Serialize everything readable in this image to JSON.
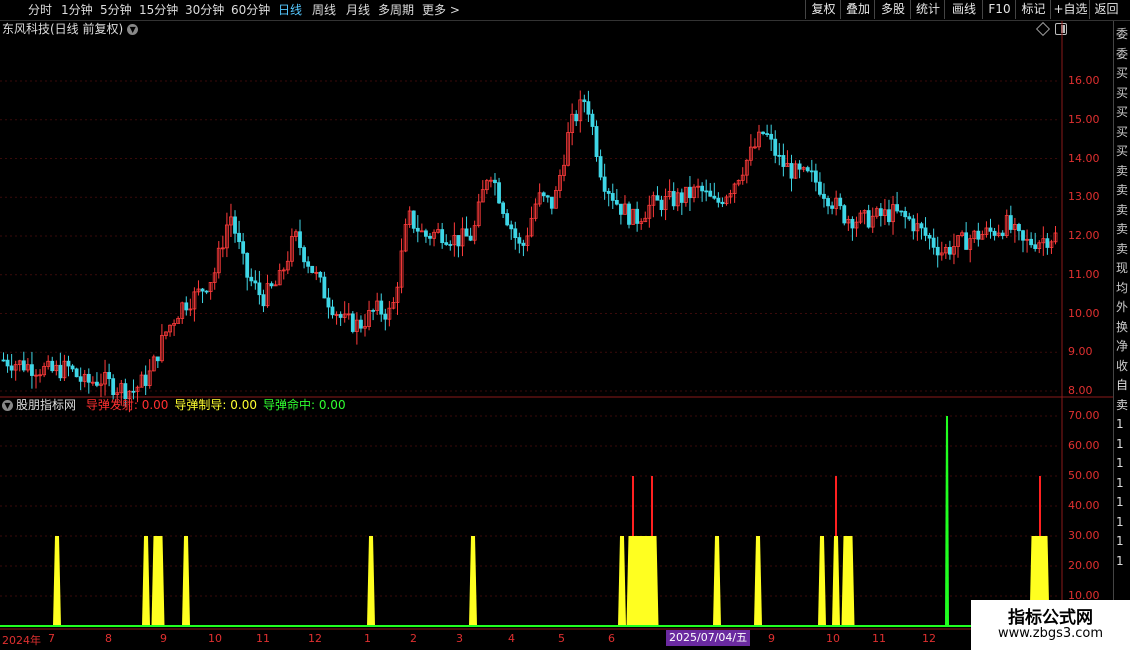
{
  "toolbar": {
    "periods": [
      {
        "label": "分时",
        "active": false
      },
      {
        "label": "1分钟",
        "active": false
      },
      {
        "label": "5分钟",
        "active": false
      },
      {
        "label": "15分钟",
        "active": false
      },
      {
        "label": "30分钟",
        "active": false
      },
      {
        "label": "60分钟",
        "active": false
      },
      {
        "label": "日线",
        "active": true
      },
      {
        "label": "周线",
        "active": false
      },
      {
        "label": "月线",
        "active": false
      },
      {
        "label": "多周期",
        "active": false
      },
      {
        "label": "更多 >",
        "active": false
      }
    ],
    "actions": [
      "复权",
      "叠加",
      "多股",
      "统计",
      "画线",
      "F10",
      "标记",
      "+自选",
      "返回"
    ]
  },
  "main": {
    "title": "东风科技(日线 前复权)",
    "price_axis": [
      "16.00",
      "15.00",
      "14.00",
      "13.00",
      "12.00",
      "11.00",
      "10.00",
      "9.00",
      "8.00"
    ]
  },
  "indicator": {
    "name": "股朋指标网",
    "items": [
      {
        "label": "导弹发射:",
        "value": "0.00",
        "color": "#ff3030"
      },
      {
        "label": "导弹制导:",
        "value": "0.00",
        "color": "#ffff30"
      },
      {
        "label": "导弹命中:",
        "value": "0.00",
        "color": "#30ff30"
      }
    ],
    "axis": [
      "70.00",
      "60.00",
      "50.00",
      "40.00",
      "30.00",
      "20.00",
      "10.00"
    ]
  },
  "time_axis": [
    "2024年",
    "7",
    "8",
    "9",
    "10",
    "11",
    "12",
    "1",
    "2",
    "3",
    "4",
    "5",
    "6",
    "9",
    "10",
    "11",
    "12"
  ],
  "date_badge": "2025/07/04/五",
  "watermark": {
    "title": "指标公式网",
    "url": "www.zbgs3.com"
  },
  "chart_data": [
    {
      "type": "line",
      "title": "东风科技(日线 前复权)",
      "series": [
        {
          "values": [
            8.8,
            8.7,
            8.6,
            8.5,
            8.6,
            8.2,
            8.3,
            8.1,
            8.0,
            8.4,
            9.5,
            10.2,
            10.5,
            11.0,
            12.6,
            11.0,
            10.4,
            10.8,
            12.0,
            11.2,
            10.4,
            9.8,
            9.7,
            10.1,
            10.0,
            12.5,
            12.0,
            12.1,
            11.9,
            12.0,
            13.8,
            12.6,
            11.6,
            13.0,
            12.8,
            14.8,
            15.6,
            13.5,
            12.8,
            12.4,
            12.8,
            12.9,
            13.0,
            13.2,
            12.8,
            13.3,
            14.0,
            14.7,
            13.9,
            13.6,
            13.5,
            13.0,
            12.5,
            12.4,
            12.5,
            12.6,
            12.4,
            12.0,
            11.6,
            11.8,
            12.0,
            12.1,
            12.3,
            11.8,
            11.9,
            12.0
          ]
        }
      ],
      "ylim": [
        7.6,
        16.5
      ]
    },
    {
      "type": "bar",
      "series": [
        {
          "name": "导弹发射",
          "color": "#ff2020",
          "values": [
            0,
            0,
            0,
            0,
            0,
            0,
            0,
            50,
            0,
            0,
            0,
            0,
            50,
            0,
            0,
            0,
            50,
            0,
            0,
            50
          ]
        },
        {
          "name": "导弹制导",
          "color": "#ffff20",
          "values": [
            30,
            30,
            30,
            30,
            30,
            30,
            30,
            30,
            30,
            30,
            30,
            30,
            30,
            30,
            30,
            30,
            30,
            30,
            30,
            30
          ]
        },
        {
          "name": "导弹命中",
          "color": "#20ff20",
          "values": [
            0,
            0,
            0,
            0,
            0,
            0,
            0,
            0,
            0,
            0,
            0,
            0,
            0,
            0,
            70,
            0,
            0,
            0,
            0,
            0
          ]
        }
      ],
      "ylim": [
        0,
        73
      ]
    }
  ],
  "right_strip": [
    "委",
    "委",
    "买",
    "买",
    "买",
    "买",
    "买",
    "卖",
    "卖",
    "卖",
    "卖",
    "卖",
    "现",
    "均",
    "外",
    "换",
    "净",
    "收",
    "自",
    "卖",
    "1",
    "1",
    "1",
    "1",
    "1",
    "1",
    "1",
    "1"
  ]
}
